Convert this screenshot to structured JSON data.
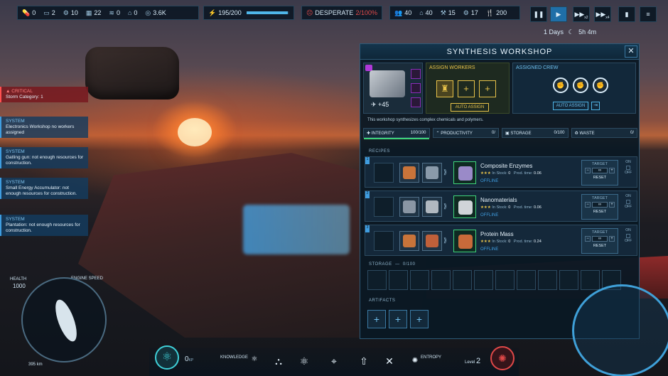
{
  "resources": {
    "items": [
      {
        "icon": "pill-icon",
        "value": "0"
      },
      {
        "icon": "battery-icon",
        "value": "2"
      },
      {
        "icon": "gear-icon",
        "value": "10"
      },
      {
        "icon": "chart-icon",
        "value": "22"
      },
      {
        "icon": "stack-icon",
        "value": "0"
      },
      {
        "icon": "house-icon",
        "value": "0"
      },
      {
        "icon": "coin-icon",
        "value": "3.6K"
      }
    ],
    "energy": {
      "value": "195/200",
      "fraction": 0.975
    },
    "mood": {
      "label": "DESPERATE",
      "value": "2/100%",
      "fraction": 0.02
    }
  },
  "crew_stats": [
    {
      "icon": "people-icon",
      "value": "40"
    },
    {
      "icon": "house-broken-icon",
      "value": "40"
    },
    {
      "icon": "hammer-icon",
      "value": "15"
    },
    {
      "icon": "gear-worker-icon",
      "value": "17"
    },
    {
      "icon": "fork-knife-icon",
      "value": "200"
    }
  ],
  "speed_controls": {
    "pause": "❚❚",
    "play": "▶",
    "fast2": "▶▶",
    "fast2_sub": "x2",
    "fast4": "▶▶",
    "fast4_sub": "x4",
    "book": "▮",
    "menu": "≡"
  },
  "time": {
    "days": "1 Days",
    "hours": "5h 4m"
  },
  "notifications": [
    {
      "type": "CRITICAL",
      "text": "Storm Category: 1"
    },
    {
      "type": "SYSTEM",
      "text": "Electronics Workshop no workers assigned"
    },
    {
      "type": "SYSTEM",
      "text": "Gatling gun: not enough resources for construction."
    },
    {
      "type": "SYSTEM",
      "text": "Small Energy Accumulator: not enough resources for construction."
    },
    {
      "type": "SYSTEM",
      "text": "Plantation: not enough resources for construction."
    }
  ],
  "workshop": {
    "title": "SYNTHESIS WORKSHOP",
    "close": "✕",
    "count": "+45",
    "assign_workers_label": "ASSIGN WORKERS",
    "auto_assign": "AUTO ASSIGN",
    "assigned_crew_label": "ASSIGNED CREW",
    "description": "This workshop synthesizes complex chemicals and polymers.",
    "stats": [
      {
        "label": "INTEGRITY",
        "value": "100/100",
        "fraction": 1.0
      },
      {
        "label": "PRODUCTIVITY",
        "value": "0/",
        "fraction": 0
      },
      {
        "label": "STORAGE",
        "value": "0/100",
        "fraction": 0
      },
      {
        "label": "WASTE",
        "value": "0/",
        "fraction": 0
      }
    ],
    "recipes_label": "RECIPES",
    "recipes": [
      {
        "num": "1",
        "name": "Composite Enzymes",
        "in_stock_label": "In Stock:",
        "in_stock": "0",
        "prod_label": "Prod. time:",
        "prod_time": "0.06",
        "status": "OFFLINE",
        "target_label": "TARGET",
        "target_value": "∞",
        "reset": "RESET",
        "on": "ON",
        "off": "OFF"
      },
      {
        "num": "2",
        "name": "Nanomaterials",
        "in_stock_label": "In Stock:",
        "in_stock": "0",
        "prod_label": "Prod. time:",
        "prod_time": "0.06",
        "status": "OFFLINE",
        "target_label": "TARGET",
        "target_value": "∞",
        "reset": "RESET",
        "on": "ON",
        "off": "OFF"
      },
      {
        "num": "3",
        "name": "Protein Mass",
        "in_stock_label": "In Stock:",
        "in_stock": "0",
        "prod_label": "Prod. time:",
        "prod_time": "0.24",
        "status": "OFFLINE",
        "target_label": "TARGET",
        "target_value": "∞",
        "reset": "RESET",
        "on": "ON",
        "off": "OFF"
      }
    ],
    "storage_label": "STORAGE",
    "storage_value": "0/100",
    "artifacts_label": "ARTIFACTS"
  },
  "hud": {
    "health_label": "HEALTH",
    "health_value": "1000",
    "engine_label": "ENGINE SPEED",
    "distance": "395 km",
    "knowledge_value": "0",
    "knowledge_unit": "KP",
    "knowledge_label": "KNOWLEDGE",
    "entropy_label": "ENTROPY",
    "level_label": "Level",
    "level_value": "2"
  },
  "colors": {
    "accent": "#3f9de0",
    "gold": "#e8c34a",
    "critical": "#ff5050",
    "green": "#3fd57a"
  }
}
